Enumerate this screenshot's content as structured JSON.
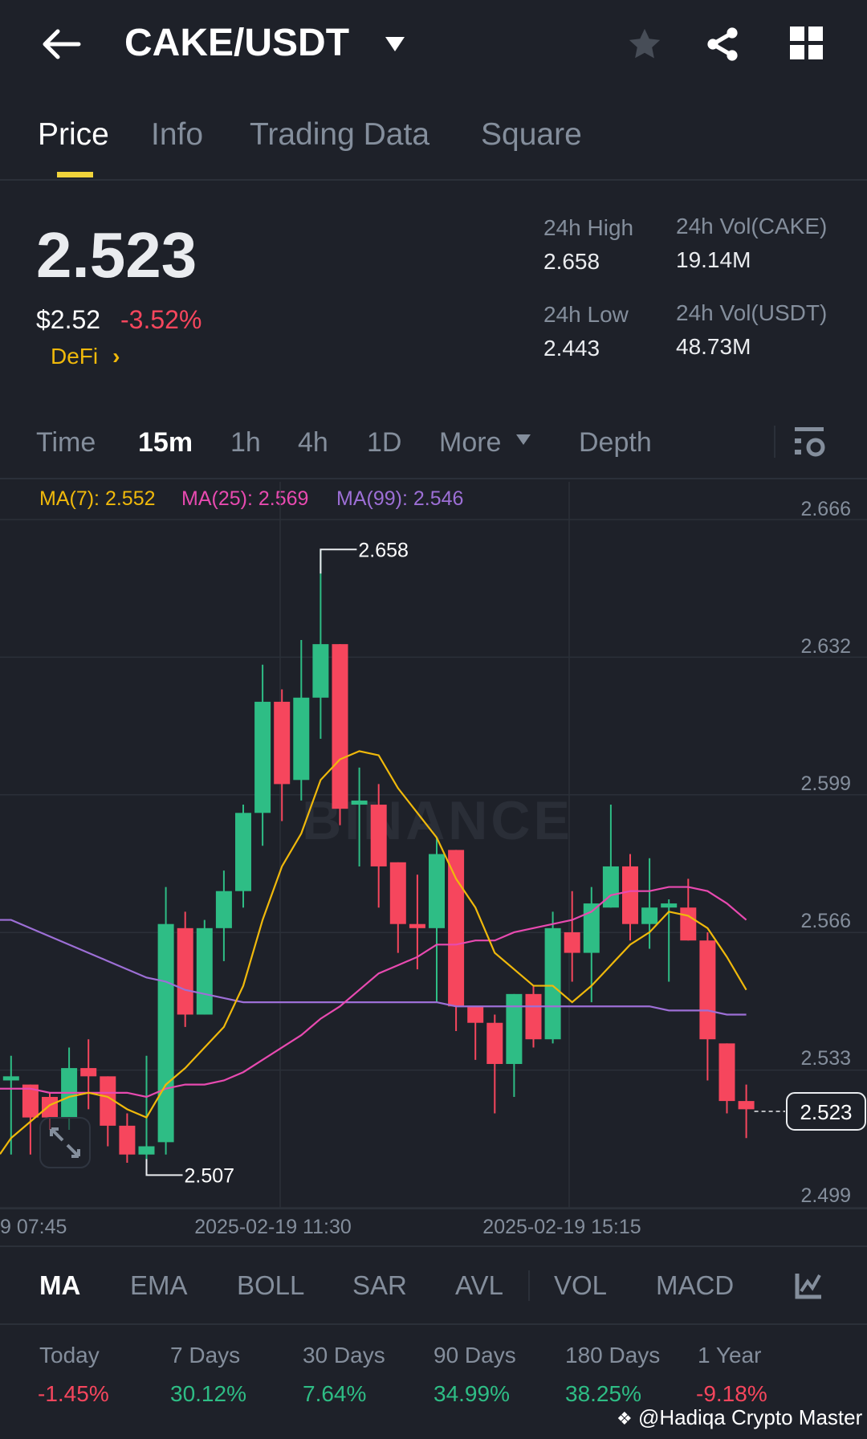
{
  "header": {
    "title": "CAKE/USDT"
  },
  "tabs": [
    {
      "label": "Price"
    },
    {
      "label": "Info"
    },
    {
      "label": "Trading Data"
    },
    {
      "label": "Square"
    }
  ],
  "ticker": {
    "last_price": "2.523",
    "usd_price": "$2.52",
    "change": "-3.52%",
    "category": "DeFi",
    "high_label": "24h High",
    "high": "2.658",
    "low_label": "24h Low",
    "low": "2.443",
    "vol_base_label": "24h Vol(CAKE)",
    "vol_base": "19.14M",
    "vol_quote_label": "24h Vol(USDT)",
    "vol_quote": "48.73M"
  },
  "intervals": [
    {
      "label": "Time"
    },
    {
      "label": "15m"
    },
    {
      "label": "1h"
    },
    {
      "label": "4h"
    },
    {
      "label": "1D"
    },
    {
      "label": "More"
    },
    {
      "label": "Depth"
    }
  ],
  "ma_legend": {
    "ma7": "MA(7): 2.552",
    "ma25": "MA(25): 2.569",
    "ma99": "MA(99): 2.546"
  },
  "colors": {
    "up": "#2ebd85",
    "down": "#f6465d",
    "ma7": "#f0b90b",
    "ma25": "#e84ab0",
    "ma99": "#9d6fd6",
    "accent": "#f0d33b"
  },
  "chart_data": {
    "type": "candlestick",
    "interval": "15m",
    "ylim": [
      2.499,
      2.666
    ],
    "y_ticks": [
      "2.666",
      "2.632",
      "2.599",
      "2.566",
      "2.533",
      "2.499"
    ],
    "x_ticks": [
      "9 07:45",
      "2025-02-19 11:30",
      "2025-02-19 15:15"
    ],
    "high_marker": "2.658",
    "low_marker": "2.507",
    "current_price": "2.523",
    "watermark": "BINANCE",
    "candles_ohlc": [
      [
        2.527,
        2.533,
        2.509,
        2.528
      ],
      [
        2.526,
        2.526,
        2.509,
        2.518
      ],
      [
        2.523,
        2.524,
        2.515,
        2.518
      ],
      [
        2.518,
        2.535,
        2.515,
        2.53
      ],
      [
        2.53,
        2.537,
        2.52,
        2.528
      ],
      [
        2.528,
        2.528,
        2.511,
        2.516
      ],
      [
        2.516,
        2.519,
        2.507,
        2.509
      ],
      [
        2.509,
        2.533,
        2.504,
        2.511
      ],
      [
        2.512,
        2.574,
        2.509,
        2.565
      ],
      [
        2.564,
        2.568,
        2.54,
        2.543
      ],
      [
        2.543,
        2.566,
        2.543,
        2.564
      ],
      [
        2.564,
        2.578,
        2.556,
        2.573
      ],
      [
        2.573,
        2.594,
        2.569,
        2.592
      ],
      [
        2.592,
        2.628,
        2.584,
        2.619
      ],
      [
        2.619,
        2.622,
        2.59,
        2.599
      ],
      [
        2.6,
        2.634,
        2.595,
        2.62
      ],
      [
        2.62,
        2.656,
        2.61,
        2.633
      ],
      [
        2.633,
        2.633,
        2.589,
        2.593
      ],
      [
        2.594,
        2.603,
        2.579,
        2.595
      ],
      [
        2.594,
        2.599,
        2.569,
        2.579
      ],
      [
        2.58,
        2.58,
        2.558,
        2.565
      ],
      [
        2.565,
        2.577,
        2.554,
        2.564
      ],
      [
        2.564,
        2.586,
        2.546,
        2.582
      ],
      [
        2.583,
        2.583,
        2.539,
        2.545
      ],
      [
        2.545,
        2.545,
        2.532,
        2.541
      ],
      [
        2.541,
        2.543,
        2.519,
        2.531
      ],
      [
        2.531,
        2.548,
        2.523,
        2.548
      ],
      [
        2.548,
        2.55,
        2.535,
        2.537
      ],
      [
        2.537,
        2.568,
        2.536,
        2.564
      ],
      [
        2.563,
        2.573,
        2.551,
        2.558
      ],
      [
        2.558,
        2.574,
        2.546,
        2.57
      ],
      [
        2.569,
        2.594,
        2.569,
        2.579
      ],
      [
        2.579,
        2.582,
        2.561,
        2.565
      ],
      [
        2.565,
        2.581,
        2.559,
        2.569
      ],
      [
        2.569,
        2.571,
        2.551,
        2.57
      ],
      [
        2.569,
        2.576,
        2.561,
        2.561
      ],
      [
        2.561,
        2.563,
        2.527,
        2.537
      ],
      [
        2.536,
        2.536,
        2.519,
        2.522
      ],
      [
        2.522,
        2.526,
        2.513,
        2.52
      ]
    ],
    "ma7": [
      2.513,
      2.517,
      2.521,
      2.523,
      2.524,
      2.523,
      2.52,
      2.518,
      2.526,
      2.53,
      2.535,
      2.54,
      2.55,
      2.566,
      2.579,
      2.587,
      2.6,
      2.605,
      2.607,
      2.606,
      2.598,
      2.592,
      2.586,
      2.576,
      2.569,
      2.558,
      2.554,
      2.55,
      2.55,
      2.546,
      2.55,
      2.555,
      2.56,
      2.563,
      2.568,
      2.567,
      2.564,
      2.557,
      2.549
    ],
    "ma25": [
      2.525,
      2.525,
      2.524,
      2.524,
      2.524,
      2.524,
      2.524,
      2.523,
      2.525,
      2.526,
      2.526,
      2.527,
      2.529,
      2.532,
      2.535,
      2.538,
      2.542,
      2.545,
      2.549,
      2.553,
      2.555,
      2.557,
      2.56,
      2.56,
      2.561,
      2.561,
      2.563,
      2.564,
      2.565,
      2.566,
      2.568,
      2.572,
      2.573,
      2.573,
      2.574,
      2.574,
      2.573,
      2.57,
      2.566
    ],
    "ma99": [
      2.566,
      2.564,
      2.562,
      2.56,
      2.558,
      2.556,
      2.554,
      2.552,
      2.551,
      2.549,
      2.548,
      2.547,
      2.546,
      2.546,
      2.546,
      2.546,
      2.546,
      2.546,
      2.546,
      2.546,
      2.546,
      2.546,
      2.546,
      2.545,
      2.545,
      2.545,
      2.545,
      2.545,
      2.545,
      2.545,
      2.545,
      2.545,
      2.545,
      2.545,
      2.544,
      2.544,
      2.544,
      2.543,
      2.543
    ]
  },
  "indicators": [
    {
      "label": "MA"
    },
    {
      "label": "EMA"
    },
    {
      "label": "BOLL"
    },
    {
      "label": "SAR"
    },
    {
      "label": "AVL"
    },
    {
      "label": "VOL"
    },
    {
      "label": "MACD"
    }
  ],
  "performance": [
    {
      "label": "Today",
      "value": "-1.45%",
      "dir": "down"
    },
    {
      "label": "7 Days",
      "value": "30.12%",
      "dir": "up"
    },
    {
      "label": "30 Days",
      "value": "7.64%",
      "dir": "up"
    },
    {
      "label": "90 Days",
      "value": "34.99%",
      "dir": "up"
    },
    {
      "label": "180 Days",
      "value": "38.25%",
      "dir": "up"
    },
    {
      "label": "1 Year",
      "value": "-9.18%",
      "dir": "down"
    }
  ],
  "watermark": "@Hadiqa Crypto Master"
}
